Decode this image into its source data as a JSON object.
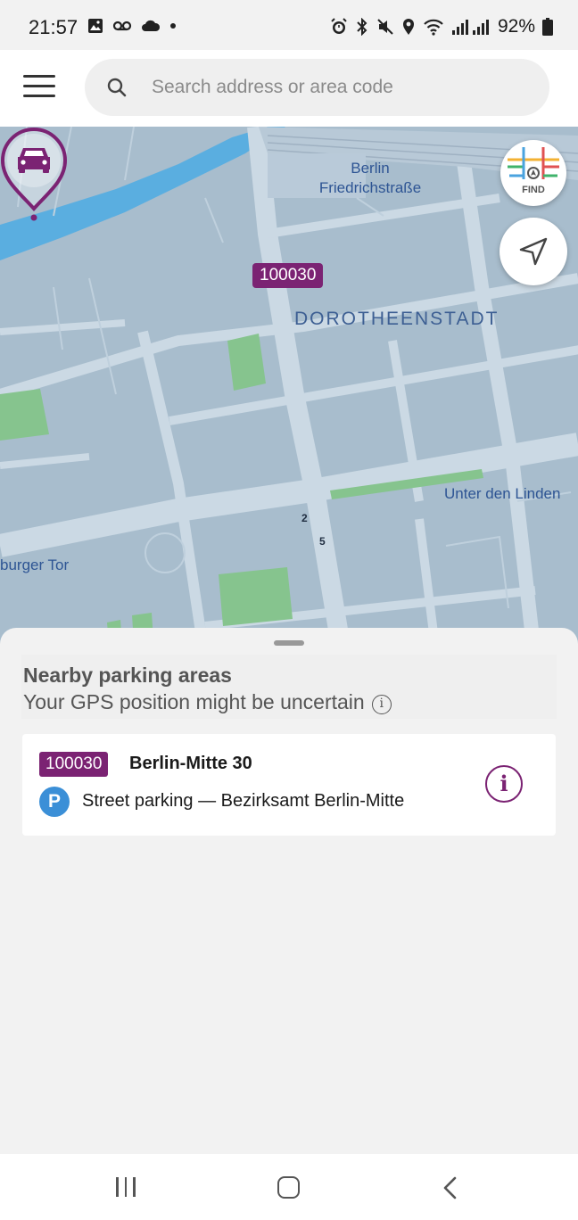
{
  "status_bar": {
    "time": "21:57",
    "battery": "92%",
    "icons": [
      "gallery-icon",
      "voicemail-icon",
      "cloud-icon",
      "dot-icon",
      "alarm-icon",
      "bluetooth-icon",
      "mute-icon",
      "location-icon",
      "wifi-icon",
      "signal-icon",
      "battery-icon"
    ]
  },
  "header": {
    "menu_icon": "hamburger-menu-icon",
    "search_placeholder": "Search address or area code"
  },
  "map": {
    "labels": {
      "station_line1": "Berlin",
      "station_line2": "Friedrichstraße",
      "district": "DOROTHEENSTADT",
      "street": "Unter den Linden",
      "gate": "burger Tor",
      "num_2": "2",
      "num_5": "5"
    },
    "pin_code": "100030",
    "find_label": "FIND",
    "colors": {
      "water": "#5aaee0",
      "land": "#a8bdcd",
      "road": "#cbd9e4",
      "park": "#86c48e",
      "accent": "#7b2373"
    }
  },
  "sheet": {
    "title": "Nearby parking areas",
    "subtitle": "Your GPS position might be uncertain",
    "items": [
      {
        "code": "100030",
        "name": "Berlin-Mitte 30",
        "type_icon": "P",
        "description": "Street parking — Bezirksamt Berlin-Mitte"
      }
    ]
  },
  "nav_bar": {
    "buttons": [
      "recent-apps",
      "home",
      "back"
    ]
  }
}
